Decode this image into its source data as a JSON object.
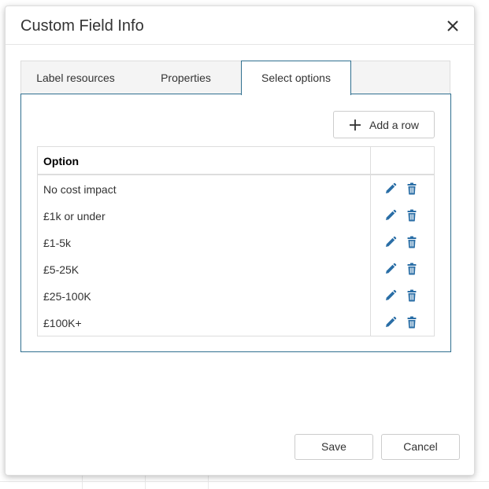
{
  "dialog": {
    "title": "Custom Field Info",
    "close_icon": "close-icon"
  },
  "tabs": [
    {
      "label": "Label resources",
      "active": false
    },
    {
      "label": "Properties",
      "active": false
    },
    {
      "label": "Select options",
      "active": true
    }
  ],
  "toolbar": {
    "add_row_label": "Add a row",
    "add_row_icon": "plus-icon"
  },
  "table": {
    "columns": [
      "Option",
      ""
    ],
    "rows": [
      {
        "option": "No cost impact"
      },
      {
        "option": "£1k or under"
      },
      {
        "option": "£1-5k"
      },
      {
        "option": "£5-25K"
      },
      {
        "option": "£25-100K"
      },
      {
        "option": "£100K+"
      }
    ],
    "row_icons": [
      "pencil-icon",
      "trash-icon"
    ]
  },
  "footer": {
    "save_label": "Save",
    "cancel_label": "Cancel"
  },
  "colors": {
    "accent": "#2f6f8f",
    "icon": "#2a6ea6"
  }
}
